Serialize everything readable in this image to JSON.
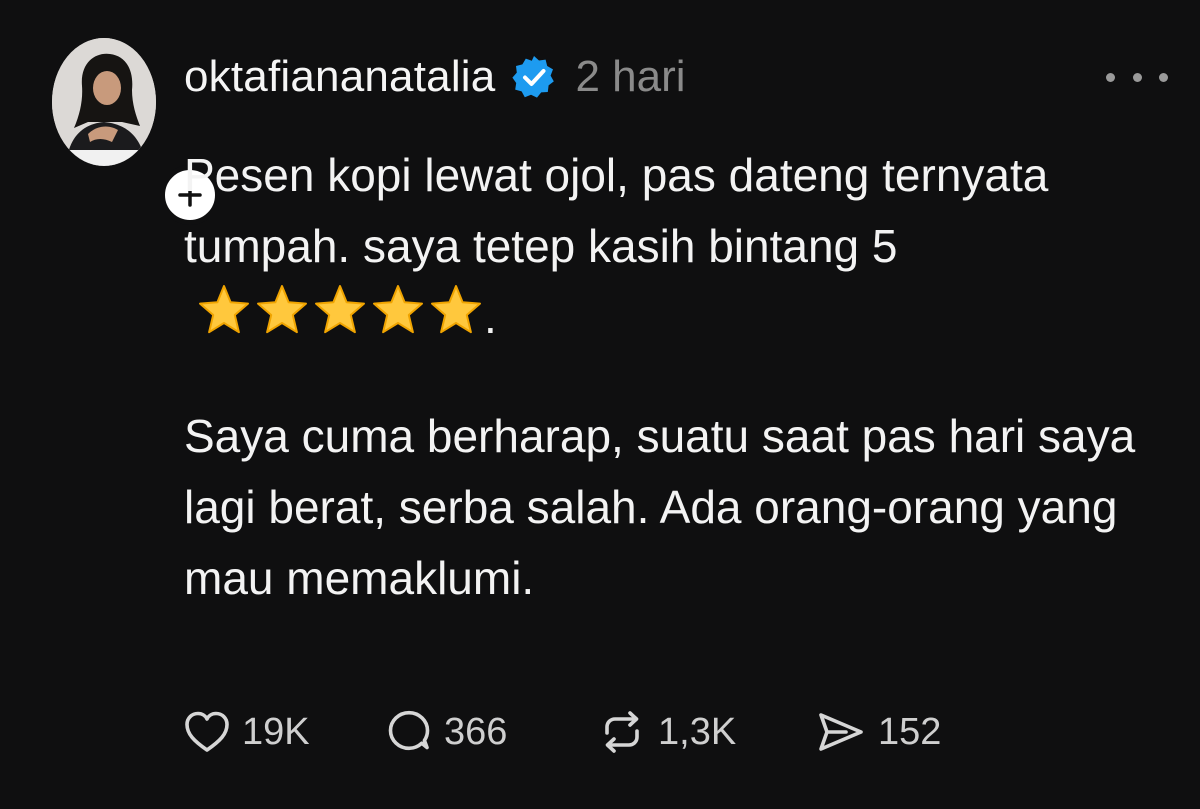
{
  "post": {
    "username": "oktafiananatalia",
    "time": "2 hari",
    "paragraph1_main": "Pesen kopi lewat ojol, pas dateng ternyata tumpah. saya tetep kasih bintang 5",
    "paragraph1_end": ".",
    "rating_stars": 5,
    "paragraph2": "Saya cuma berharap, suatu saat pas hari saya lagi berat, serba salah. Ada orang-orang yang mau memaklumi."
  },
  "actions": {
    "likes": "19K",
    "replies": "366",
    "reposts": "1,3K",
    "shares": "152"
  },
  "icons": {
    "verified": "verified-badge-icon",
    "follow": "plus-icon",
    "more": "more-dots-icon",
    "like": "heart-icon",
    "reply": "speech-bubble-icon",
    "repost": "repost-arrows-icon",
    "share": "send-icon",
    "star": "star-emoji-icon"
  },
  "colors": {
    "background": "#0f0f10",
    "text": "#f3f3f3",
    "muted": "#8a8a8a",
    "verified": "#1d9bf0",
    "star": "#ffc83d"
  }
}
